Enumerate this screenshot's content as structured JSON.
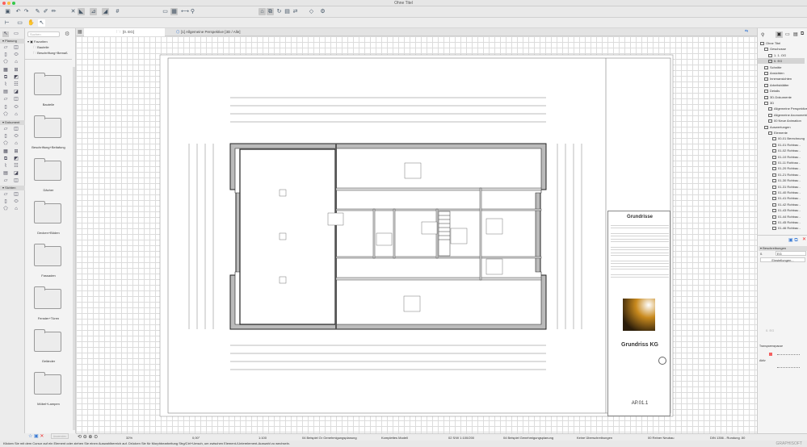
{
  "window": {
    "title": "Ohne Titel"
  },
  "tabs": [
    {
      "label": "[0. EG]"
    },
    {
      "label": "[1] Allgemeine Perspektive [3D / Alle]"
    }
  ],
  "favorites": {
    "search_placeholder": "Suchen",
    "root": "Favoriten",
    "tree": [
      "Bauteile",
      "Beschriftung+Bemaß"
    ],
    "folders": [
      "Bauteile",
      "Beschriftung+Beitafung",
      "Dächer",
      "Decken+Böden",
      "Fassaden",
      "Fenster+Türen",
      "Geländer",
      "Möbel+Lampen"
    ],
    "apply_button": "Anwenden"
  },
  "toolbox": {
    "sections": [
      "Planung",
      "Dokument",
      "Sichten"
    ]
  },
  "navigator": {
    "items": [
      {
        "label": "Ohne Titel",
        "level": 0
      },
      {
        "label": "Geschosse",
        "level": 1
      },
      {
        "label": "1. 1. OG",
        "level": 2
      },
      {
        "label": "0. EG",
        "level": 2,
        "selected": true
      },
      {
        "label": "Schnitte",
        "level": 1
      },
      {
        "label": "Ansichten",
        "level": 1
      },
      {
        "label": "Innenansichten",
        "level": 1
      },
      {
        "label": "Arbeitsblätter",
        "level": 1
      },
      {
        "label": "Details",
        "level": 1
      },
      {
        "label": "3D-Dokumente",
        "level": 1
      },
      {
        "label": "3D",
        "level": 1
      },
      {
        "label": "Allgemeine Perspektive",
        "level": 2
      },
      {
        "label": "Allgemeine Axonometrie",
        "level": 2
      },
      {
        "label": "00 Neue Animation",
        "level": 2
      },
      {
        "label": "Auswertungen",
        "level": 1
      },
      {
        "label": "Elemente",
        "level": 2
      },
      {
        "label": "00-01 Berechnung",
        "level": 3
      },
      {
        "label": "01-01 Rohbau - ",
        "level": 3
      },
      {
        "label": "01-02 Rohbau - ",
        "level": 3
      },
      {
        "label": "01-10 Rohbau - ",
        "level": 3
      },
      {
        "label": "01-11 Rohbau - ",
        "level": 3
      },
      {
        "label": "01-20 Rohbau - ",
        "level": 3
      },
      {
        "label": "01-21 Rohbau - ",
        "level": 3
      },
      {
        "label": "01-30 Rohbau - ",
        "level": 3
      },
      {
        "label": "01-31 Rohbau - ",
        "level": 3
      },
      {
        "label": "01-40 Rohbau - ",
        "level": 3
      },
      {
        "label": "01-41 Rohbau - ",
        "level": 3
      },
      {
        "label": "01-42 Rohbau - ",
        "level": 3
      },
      {
        "label": "01-43 Rohbau - ",
        "level": 3
      },
      {
        "label": "01-44 Rohbau - ",
        "level": 3
      },
      {
        "label": "01-45 Rohbau - ",
        "level": 3
      },
      {
        "label": "01-46 Rohbau - ",
        "level": 3
      }
    ]
  },
  "properties": {
    "header": "Beschreibungen",
    "id": "0.",
    "name": "EG",
    "settings_button": "Einstellungen...",
    "layer": "0. EG",
    "transparency_label": "Transparenzpause",
    "active_label": "Aktiv"
  },
  "titleblock": {
    "section": "Grundrisse",
    "title": "Grundriss KG",
    "sheet": "AP.01.1"
  },
  "status": {
    "zoom": "32%",
    "angle": "0,00°",
    "scale": "1:100",
    "layer_combo": "04 Beispiel Gr Genehmigungsplanung",
    "model": "Komplettes Modell",
    "pen_set": "02 S/W 1:100/200",
    "mvo": "04 Beispiel Genehmigungsplanung",
    "override": "Keine Überschreibungen",
    "renovation": "00 Reiner Neubau",
    "dimension": "DIN 1356 - Rundung .50"
  },
  "message": "Klicken Sie mit dem Cursor auf ein Element oder ziehen Sie einen Auswahlbereich auf. Drücken Sie für Morphbearbeitung Strg/Ctrl+Umsch, um zwischen Element-/Unterelement-Auswahl zu wechseln.",
  "brand": "GRAPHISOFT"
}
